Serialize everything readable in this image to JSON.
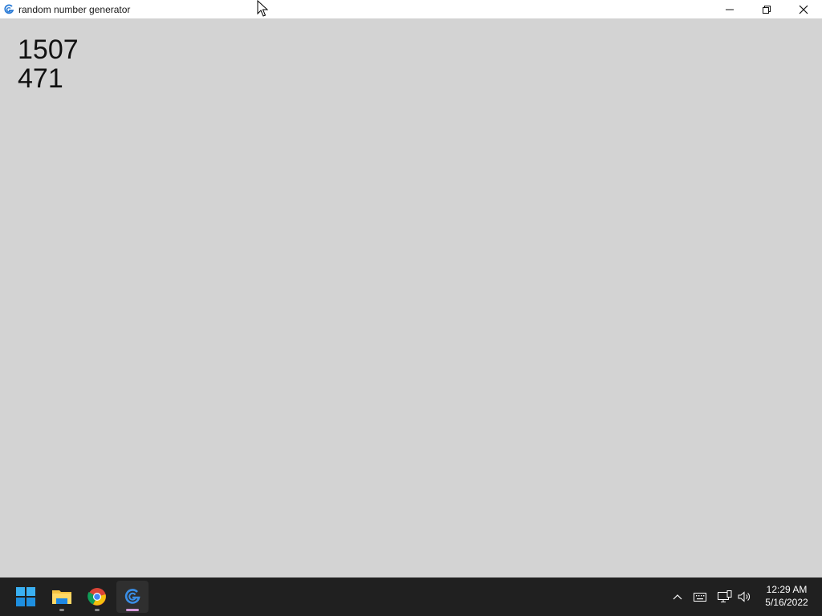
{
  "window": {
    "title": "random number generator",
    "icons": {
      "app": "app-logo-icon",
      "minimize": "minimize-icon",
      "restore": "restore-icon",
      "close": "close-icon"
    }
  },
  "content": {
    "numbers": [
      "1507",
      "471"
    ]
  },
  "taskbar": {
    "apps": [
      {
        "name": "start",
        "icon": "windows-start-icon"
      },
      {
        "name": "file-explorer",
        "icon": "folder-icon"
      },
      {
        "name": "chrome",
        "icon": "chrome-icon"
      },
      {
        "name": "random-number-generator",
        "icon": "app-logo-icon",
        "active": true
      }
    ],
    "tray": {
      "icons": [
        "chevron-up-icon",
        "keyboard-icon",
        "network-icon",
        "volume-icon"
      ]
    },
    "clock": {
      "time": "12:29 AM",
      "date": "5/16/2022"
    }
  },
  "colors": {
    "window_bg": "#d3d3d3",
    "titlebar_bg": "#ffffff",
    "taskbar_bg": "#202020",
    "accent": "#0078d4"
  }
}
